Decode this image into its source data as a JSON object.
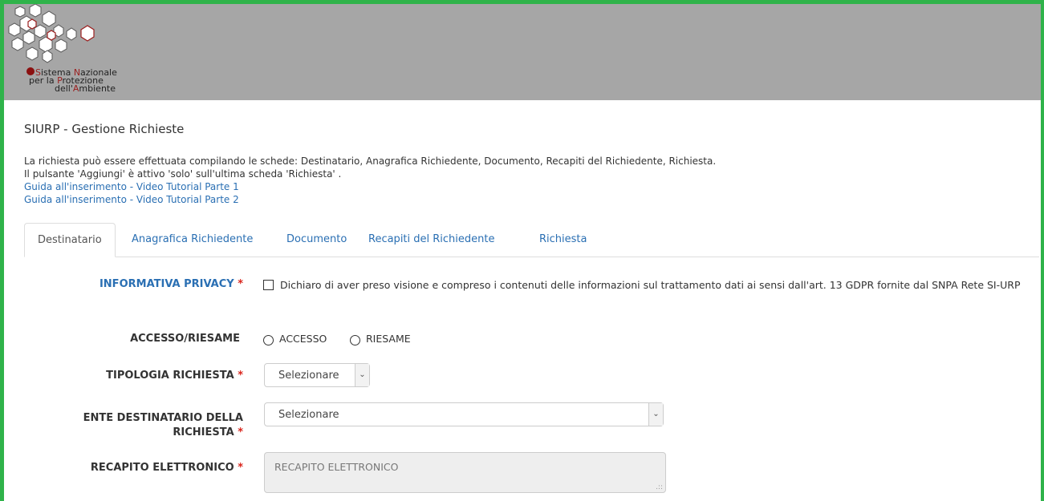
{
  "logo": {
    "line1_a": "S",
    "line1_b": "istema ",
    "line1_c": "N",
    "line1_d": "azionale",
    "line2_a": "per la ",
    "line2_b": "P",
    "line2_c": "rotezione",
    "line3_a": "dell'",
    "line3_b": "A",
    "line3_c": "mbiente"
  },
  "page": {
    "title": "SIURP - Gestione Richieste",
    "intro_line1": "La richiesta può essere effettuata compilando le schede: Destinatario, Anagrafica Richiedente, Documento, Recapiti del Richiedente, Richiesta.",
    "intro_line2": "Il pulsante 'Aggiungi' è attivo 'solo' sull'ultima scheda 'Richiesta' .",
    "link1": "Guida all'inserimento - Video Tutorial Parte 1",
    "link2": "Guida all'inserimento - Video Tutorial Parte 2"
  },
  "tabs": [
    {
      "label": "Destinatario",
      "active": true
    },
    {
      "label": "Anagrafica Richiedente",
      "active": false
    },
    {
      "label": "Documento",
      "active": false
    },
    {
      "label": "Recapiti del Richiedente",
      "active": false
    },
    {
      "label": "Richiesta",
      "active": false
    }
  ],
  "form": {
    "privacy_label": "INFORMATIVA PRIVACY",
    "required_mark": "*",
    "privacy_text": "Dichiaro di aver preso visione e compreso i contenuti delle informazioni sul trattamento dati ai sensi dall'art. 13 GDPR fornite dal SNPA Rete SI-URP",
    "accesso_label": "ACCESSO/RIESAME",
    "radio_accesso": "ACCESSO",
    "radio_riesame": "RIESAME",
    "tipologia_label": "TIPOLOGIA RICHIESTA",
    "tipologia_value": "Selezionare",
    "ente_label_line1": "ENTE DESTINATARIO DELLA",
    "ente_label_line2": "RICHIESTA",
    "ente_value": "Selezionare",
    "recapito_label": "RECAPITO ELETTRONICO",
    "recapito_placeholder": "RECAPITO ELETTRONICO"
  },
  "colors": {
    "frame": "#2fb34a",
    "header_bg": "#a6a6a6",
    "link": "#2a6fb3",
    "required": "#d9251c"
  }
}
